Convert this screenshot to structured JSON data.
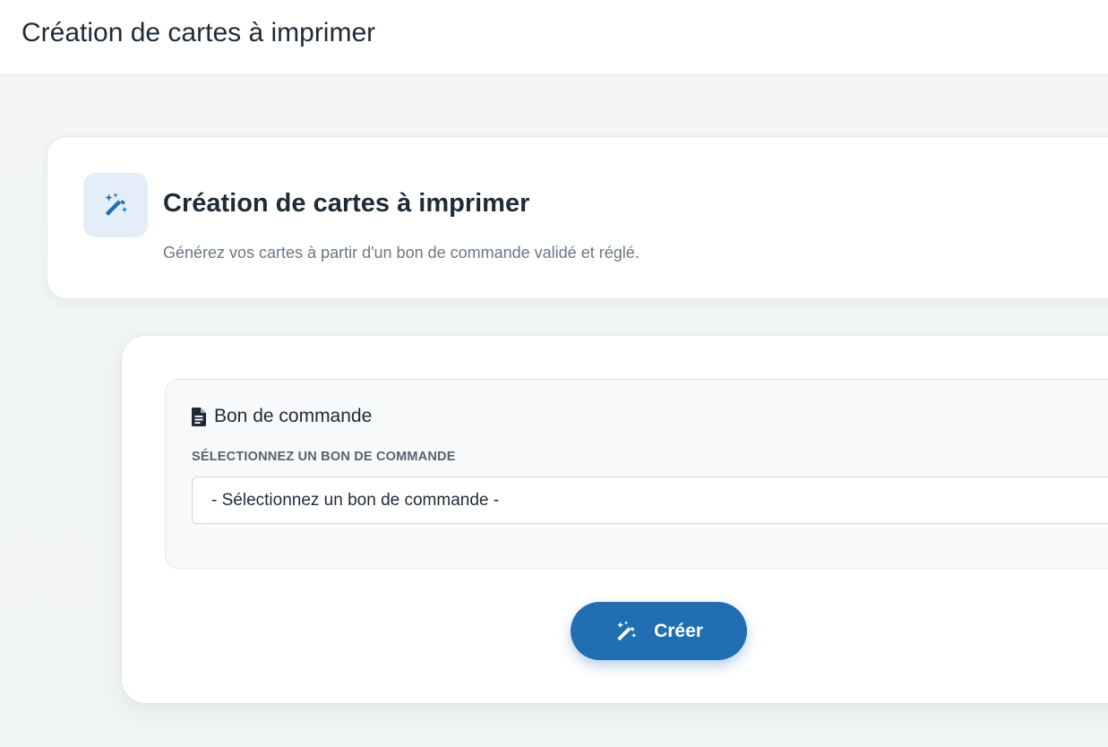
{
  "topbar": {
    "title": "Création de cartes à imprimer"
  },
  "header": {
    "icon": "magic-wand-icon",
    "title": "Création de cartes à imprimer",
    "subtitle": "Générez vos cartes à partir d'un bon de commande validé et réglé."
  },
  "section": {
    "icon": "document-icon",
    "title": "Bon de commande",
    "field_label": "SÉLECTIONNEZ UN BON DE COMMANDE",
    "select": {
      "selected": "- Sélectionnez un bon de commande -"
    }
  },
  "actions": {
    "create_icon": "magic-wand-icon",
    "create_label": "Créer"
  },
  "colors": {
    "primary": "#216eb3",
    "icon_box_bg": "#e3eef8",
    "page_bg": "#f2f5f2"
  }
}
